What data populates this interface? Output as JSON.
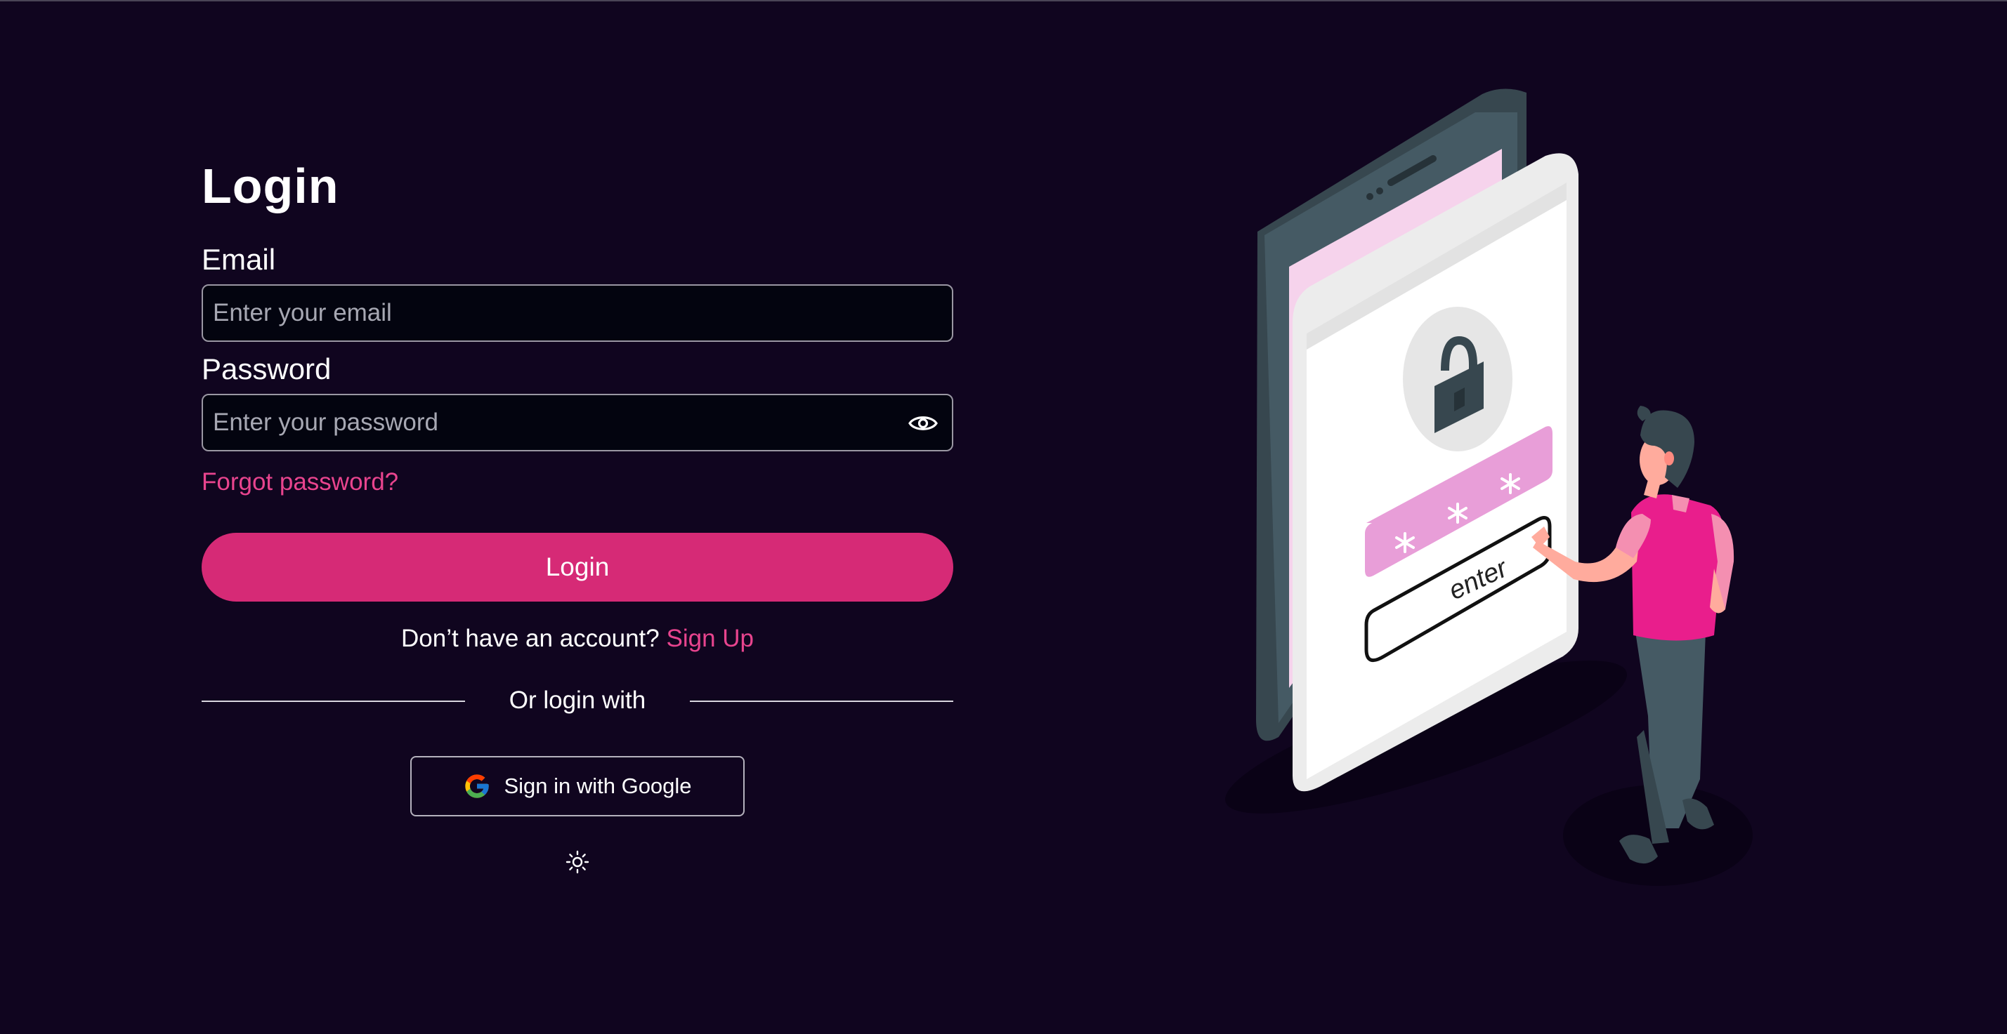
{
  "login": {
    "title": "Login",
    "email_label": "Email",
    "email_placeholder": "Enter your email",
    "email_value": "",
    "password_label": "Password",
    "password_placeholder": "Enter your password",
    "password_value": "",
    "forgot_label": "Forgot password?",
    "login_button": "Login",
    "no_account_text": "Don’t have an account?",
    "signup_link": "Sign Up",
    "divider_text": "Or login with",
    "google_button": "Sign in with Google"
  },
  "illustration": {
    "button_text": "enter",
    "icons": [
      "lock-icon",
      "eye-icon",
      "sun-icon",
      "google-icon"
    ]
  },
  "colors": {
    "background": "#10051f",
    "accent": "#d62a76",
    "link": "#e8448e",
    "input_bg": "#03040f"
  }
}
